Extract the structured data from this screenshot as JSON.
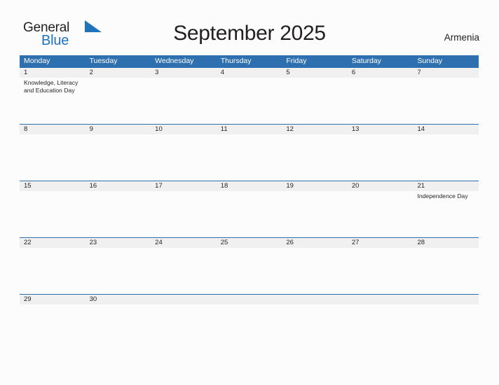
{
  "brand": {
    "name_part1": "General",
    "name_part2": "Blue",
    "flag_icon": "blue-triangle-flag-icon",
    "colors": {
      "text_dark": "#231f20",
      "blue": "#1f72bb",
      "header_blue": "#2e6fb0",
      "band_gray": "#f0f0f0"
    }
  },
  "header": {
    "title": "September 2025",
    "country": "Armenia"
  },
  "calendar": {
    "weekdays": [
      "Monday",
      "Tuesday",
      "Wednesday",
      "Thursday",
      "Friday",
      "Saturday",
      "Sunday"
    ],
    "weeks": [
      {
        "days": [
          {
            "date": "1",
            "event": "Knowledge, Literacy and Education Day"
          },
          {
            "date": "2",
            "event": ""
          },
          {
            "date": "3",
            "event": ""
          },
          {
            "date": "4",
            "event": ""
          },
          {
            "date": "5",
            "event": ""
          },
          {
            "date": "6",
            "event": ""
          },
          {
            "date": "7",
            "event": ""
          }
        ]
      },
      {
        "days": [
          {
            "date": "8",
            "event": ""
          },
          {
            "date": "9",
            "event": ""
          },
          {
            "date": "10",
            "event": ""
          },
          {
            "date": "11",
            "event": ""
          },
          {
            "date": "12",
            "event": ""
          },
          {
            "date": "13",
            "event": ""
          },
          {
            "date": "14",
            "event": ""
          }
        ]
      },
      {
        "days": [
          {
            "date": "15",
            "event": ""
          },
          {
            "date": "16",
            "event": ""
          },
          {
            "date": "17",
            "event": ""
          },
          {
            "date": "18",
            "event": ""
          },
          {
            "date": "19",
            "event": ""
          },
          {
            "date": "20",
            "event": ""
          },
          {
            "date": "21",
            "event": "Independence Day"
          }
        ]
      },
      {
        "days": [
          {
            "date": "22",
            "event": ""
          },
          {
            "date": "23",
            "event": ""
          },
          {
            "date": "24",
            "event": ""
          },
          {
            "date": "25",
            "event": ""
          },
          {
            "date": "26",
            "event": ""
          },
          {
            "date": "27",
            "event": ""
          },
          {
            "date": "28",
            "event": ""
          }
        ]
      },
      {
        "days": [
          {
            "date": "29",
            "event": ""
          },
          {
            "date": "30",
            "event": ""
          },
          {
            "date": "",
            "event": ""
          },
          {
            "date": "",
            "event": ""
          },
          {
            "date": "",
            "event": ""
          },
          {
            "date": "",
            "event": ""
          },
          {
            "date": "",
            "event": ""
          }
        ]
      }
    ]
  }
}
